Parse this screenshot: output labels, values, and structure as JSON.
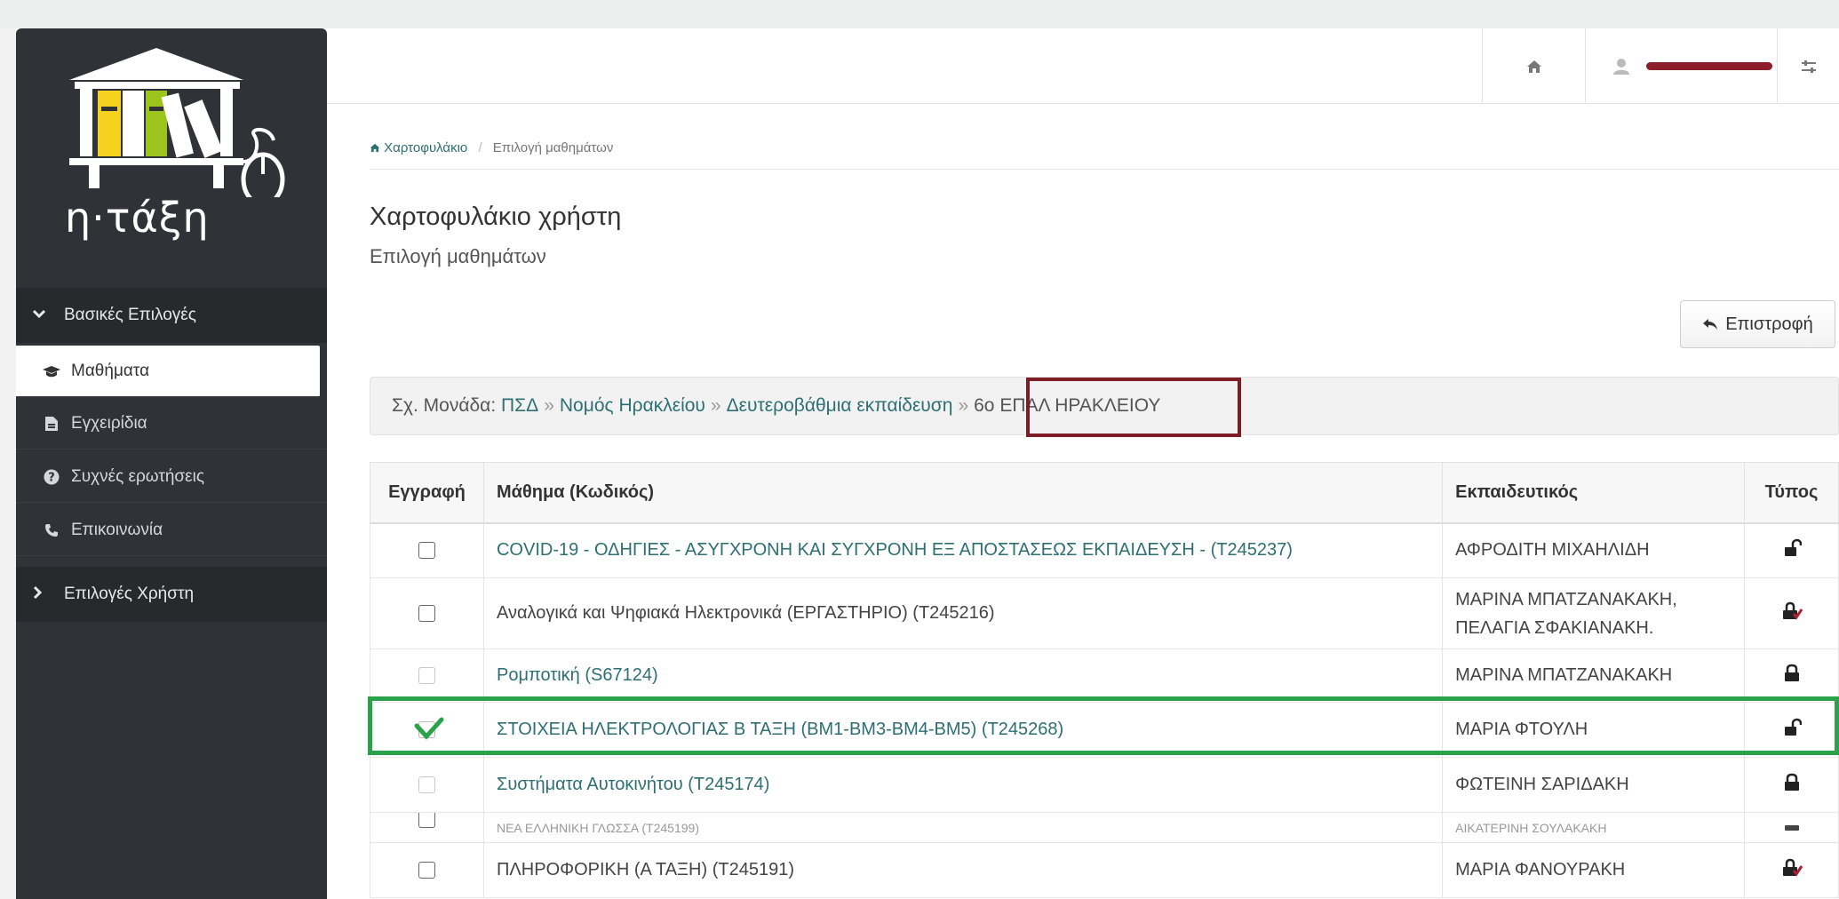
{
  "app": {
    "logo_text": "η·τάξη"
  },
  "sidebar": {
    "sections": [
      {
        "label": "Βασικές Επιλογές",
        "expanded": true
      },
      {
        "label": "Επιλογές Χρήστη",
        "expanded": false
      }
    ],
    "items": [
      {
        "label": "Μαθήματα",
        "icon": "graduation-cap-icon",
        "active": true
      },
      {
        "label": "Εγχειρίδια",
        "icon": "file-icon",
        "active": false
      },
      {
        "label": "Συχνές ερωτήσεις",
        "icon": "question-circle-icon",
        "active": false
      },
      {
        "label": "Επικοινωνία",
        "icon": "phone-icon",
        "active": false
      }
    ]
  },
  "header": {
    "home_icon": "home-icon",
    "user_icon": "user-icon",
    "settings_icon": "settings-icon"
  },
  "breadcrumb": {
    "home": "Χαρτοφυλάκιο",
    "separator": "/",
    "current": "Επιλογή μαθημάτων"
  },
  "page": {
    "title": "Χαρτοφυλάκιο χρήστη",
    "subtitle": "Επιλογή μαθημάτων"
  },
  "back_button": {
    "label": "Επιστροφή"
  },
  "school_path": {
    "prefix": "Σχ. Μονάδα:",
    "links": [
      "ΠΣΔ",
      "Νομός Ηρακλείου",
      "Δευτεροβάθμια εκπαίδευση"
    ],
    "current": "6ο ΕΠΑΛ ΗΡΑΚΛΕΙΟΥ",
    "separator": "»"
  },
  "table": {
    "headers": {
      "enroll": "Εγγραφή",
      "course": "Μάθημα (Κωδικός)",
      "teacher": "Εκπαιδευτικός",
      "type": "Τύπος"
    },
    "rows": [
      {
        "course": "COVID-19 - ΟΔΗΓΙΕΣ - ΑΣΥΓΧΡΟΝΗ ΚΑΙ ΣΥΓΧΡΟΝΗ ΕΞ ΑΠΟΣΤΑΣΕΩΣ ΕΚΠΑΙΔΕΥΣΗ - (T245237)",
        "teacher": "ΑΦΡΟΔΙΤΗ ΜΙΧΑΗΛΙΔΗ",
        "lock": "open",
        "checked": false,
        "disabled": false,
        "link": true
      },
      {
        "course": "Αναλογικά και Ψηφιακά Ηλεκτρονικά (ΕΡΓΑΣΤΗΡΙΟ) (T245216)",
        "teacher": "ΜΑΡΙΝΑ ΜΠΑΤΖΑΝΑΚΑΚΗ, ΠΕΛΑΓΙΑ ΣΦΑΚΙΑΝΑΚΗ.",
        "lock": "locked-red",
        "checked": false,
        "disabled": false,
        "link": false
      },
      {
        "course": "Ρομποτική (S67124)",
        "teacher": "ΜΑΡΙΝΑ ΜΠΑΤΖΑΝΑΚΑΚΗ",
        "lock": "locked",
        "checked": false,
        "disabled": true,
        "link": true
      },
      {
        "course": "ΣΤΟΙΧΕΙΑ ΗΛΕΚΤΡΟΛΟΓΙΑΣ Β ΤΑΞΗ (ΒΜ1-ΒΜ3-ΒΜ4-ΒΜ5) (T245268)",
        "teacher": "ΜΑΡΙΑ ΦΤΟΥΛΗ",
        "lock": "open",
        "checked": true,
        "disabled": false,
        "link": true
      },
      {
        "course": "Συστήματα Αυτοκινήτου (T245174)",
        "teacher": "ΦΩΤΕΙΝΗ ΣΑΡΙΔΑΚΗ",
        "lock": "locked",
        "checked": false,
        "disabled": true,
        "link": true
      },
      {
        "course": "ΝΕΑ ΕΛΛΗΝΙΚΗ ΓΛΩΣΣΑ (Τ245199)",
        "teacher": "ΑΙΚΑΤΕΡΙΝΗ ΣΟΥΛΑΚΑΚΗ",
        "lock": "locked",
        "checked": false,
        "disabled": false,
        "link": false
      },
      {
        "course": "ΠΛΗΡΟΦΟΡΙΚΗ (Α ΤΑΞΗ) (T245191)",
        "teacher": "ΜΑΡΙΑ ΦΑΝΟΥΡΑΚΗ",
        "lock": "locked-red",
        "checked": false,
        "disabled": false,
        "link": false
      }
    ]
  },
  "colors": {
    "sidebar_bg": "#2f3237",
    "link": "#2e6f73",
    "highlight_red": "#7f1d25",
    "highlight_green": "#2aa24a"
  }
}
